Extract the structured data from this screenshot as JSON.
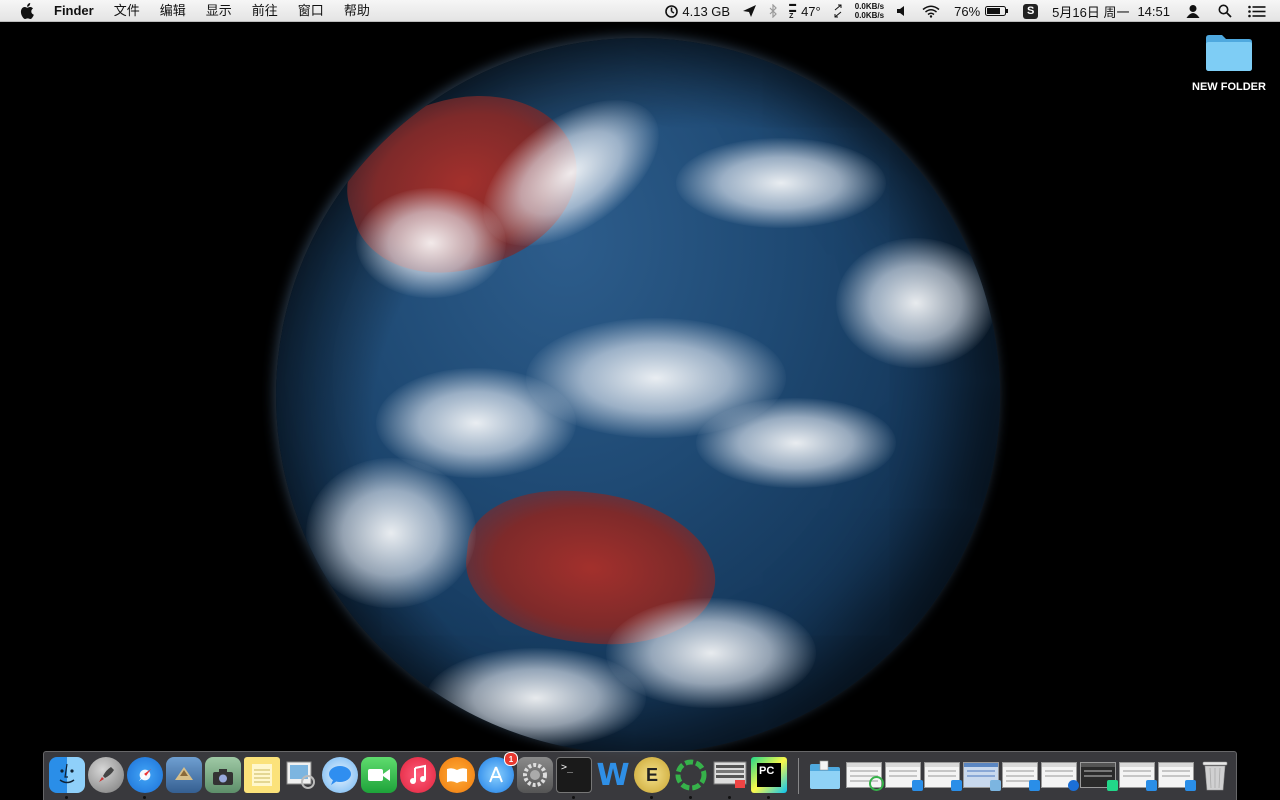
{
  "menubar": {
    "apple_icon": "apple-logo",
    "app_name": "Finder",
    "menus": [
      "文件",
      "编辑",
      "显示",
      "前往",
      "窗口",
      "帮助"
    ],
    "status": {
      "memory": "4.13 GB",
      "temperature": "47°",
      "net_up": "0.0KB/s",
      "net_down": "0.0KB/s",
      "battery": "76%",
      "date": "5月16日 周一",
      "time": "14:51"
    }
  },
  "desktop": {
    "folder_label": "NEW FOLDER",
    "wallpaper": "earth-from-space"
  },
  "dock": {
    "apps": [
      {
        "name": "Finder",
        "running": true
      },
      {
        "name": "Launchpad",
        "running": false
      },
      {
        "name": "Safari",
        "running": true
      },
      {
        "name": "Mail",
        "running": false
      },
      {
        "name": "Image Capture",
        "running": false
      },
      {
        "name": "Notes",
        "running": false
      },
      {
        "name": "Preview",
        "running": false
      },
      {
        "name": "Messages",
        "running": false
      },
      {
        "name": "FaceTime",
        "running": false
      },
      {
        "name": "Music",
        "running": false
      },
      {
        "name": "iBooks",
        "running": false
      },
      {
        "name": "App Store",
        "running": false,
        "badge": "1"
      },
      {
        "name": "System Preferences",
        "running": false
      },
      {
        "name": "Terminal",
        "running": true
      },
      {
        "name": "Word",
        "running": false
      },
      {
        "name": "Evernote",
        "running": true
      },
      {
        "name": "Sync",
        "running": true
      },
      {
        "name": "Screen",
        "running": true
      },
      {
        "name": "PyCharm",
        "running": true
      }
    ],
    "terminal_glyph": ">_",
    "pycharm_glyph": "PC",
    "word_glyph": "W",
    "evernote_glyph": "E",
    "minimized_windows": 10
  },
  "colors": {
    "menubar": "#ececec",
    "dock": "#46464a",
    "folder": "#6cc3f2",
    "notification": "#e8382f"
  }
}
